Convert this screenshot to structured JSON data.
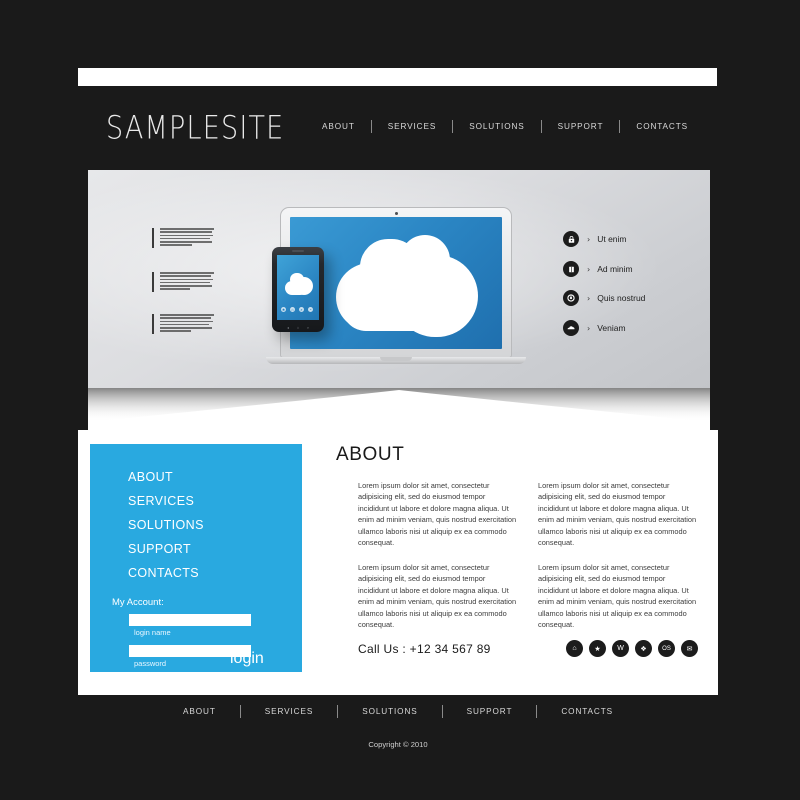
{
  "site": {
    "logo": "SAMPLESITE",
    "copyright": "Copyright © 2010"
  },
  "header": {
    "nav": [
      {
        "label": "ABOUT"
      },
      {
        "label": "SERVICES"
      },
      {
        "label": "SOLUTIONS"
      },
      {
        "label": "SUPPORT"
      },
      {
        "label": "CONTACTS"
      }
    ]
  },
  "hero": {
    "features": [
      {
        "icon": "lock-icon",
        "arrow": "›",
        "label": "Ut enim"
      },
      {
        "icon": "book-icon",
        "arrow": "›",
        "label": "Ad minim"
      },
      {
        "icon": "clock-icon",
        "arrow": "›",
        "label": "Quis nostrud"
      },
      {
        "icon": "cloud-icon",
        "arrow": "›",
        "label": "Veniam"
      }
    ],
    "device_graphic": "laptop-and-phone-cloud-illustration"
  },
  "sidebar": {
    "nav": [
      {
        "label": "ABOUT"
      },
      {
        "label": "SERVICES"
      },
      {
        "label": "SOLUTIONS"
      },
      {
        "label": "SUPPORT"
      },
      {
        "label": "CONTACTS"
      }
    ],
    "account_label": "My Account:",
    "login_name_value": "",
    "login_name_placeholder": "",
    "login_name_hint": "login name",
    "password_value": "",
    "password_placeholder": "",
    "password_hint": "password",
    "login_button": "login"
  },
  "main": {
    "title": "ABOUT",
    "paragraphs": [
      "Lorem ipsum dolor sit amet, consectetur adipisicing elit, sed do eiusmod tempor incididunt ut labore et dolore magna aliqua. Ut enim ad minim veniam, quis nostrud exercitation ullamco laboris nisi ut aliquip ex ea commodo consequat.",
      "Lorem ipsum dolor sit amet, consectetur adipisicing elit, sed do eiusmod tempor incididunt ut labore et dolore magna aliqua. Ut enim ad minim veniam, quis nostrud exercitation ullamco laboris nisi ut aliquip ex ea commodo consequat.",
      "Lorem ipsum dolor sit amet, consectetur adipisicing elit, sed do eiusmod tempor incididunt ut labore et dolore magna aliqua. Ut enim ad minim veniam, quis nostrud exercitation ullamco laboris nisi ut aliquip ex ea commodo consequat.",
      "Lorem ipsum dolor sit amet, consectetur adipisicing elit, sed do eiusmod tempor incididunt ut labore et dolore magna aliqua. Ut enim ad minim veniam, quis nostrud exercitation ullamco laboris nisi ut aliquip ex ea commodo consequat."
    ],
    "call_us": "Call Us : +12 34 567 89",
    "social": [
      {
        "icon": "home-flame-icon",
        "glyph": "⌂"
      },
      {
        "icon": "star-icon",
        "glyph": "★"
      },
      {
        "icon": "wordpress-icon",
        "glyph": "W"
      },
      {
        "icon": "compass-icon",
        "glyph": "❖"
      },
      {
        "icon": "os-icon",
        "glyph": "OS"
      },
      {
        "icon": "envelope-icon",
        "glyph": "✉"
      }
    ]
  },
  "footer": {
    "nav": [
      {
        "label": "ABOUT"
      },
      {
        "label": "SERVICES"
      },
      {
        "label": "SOLUTIONS"
      },
      {
        "label": "SUPPORT"
      },
      {
        "label": "CONTACTS"
      }
    ]
  },
  "colors": {
    "page_background": "#1a1a1a",
    "accent_blue": "#29a9e0",
    "content_background": "#ffffff",
    "hero_background": "#dcdde0",
    "icon_dark": "#1c1c1c"
  }
}
